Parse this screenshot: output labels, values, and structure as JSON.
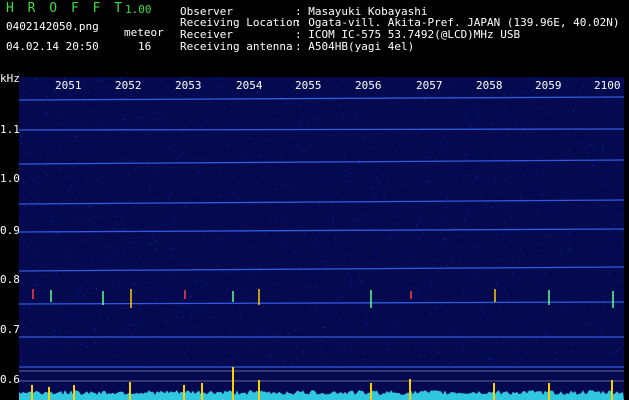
{
  "app": {
    "name_letters": "H R O F F T",
    "version": "1.00",
    "filename": "0402142050.png",
    "mode_label": "meteor",
    "datetime": "04.02.14 20:50",
    "count": "16"
  },
  "info": {
    "observer_label": "Observer",
    "observer_value": ": Masayuki Kobayashi",
    "location_label": "Receiving Location",
    "location_value": ": Ogata-vill. Akita-Pref. JAPAN (139.96E, 40.02N)",
    "receiver_label": "Receiver",
    "receiver_value": ": ICOM IC-575 53.7492(@LCD)MHz USB",
    "antenna_label": "Receiving antenna",
    "antenna_value": ": A504HB(yagi 4el)"
  },
  "spectrogram": {
    "time_labels": [
      "2051",
      "2052",
      "2053",
      "2054",
      "2055",
      "2056",
      "2057",
      "2058",
      "2059",
      "2100"
    ],
    "freq_unit": "kHz",
    "freq_labels": [
      "1.1",
      "1.0",
      "0.9",
      "0.8",
      "0.7",
      "0.6"
    ],
    "colors": {
      "background": "#050a50",
      "carrier": "#3a70ff",
      "meteor": "#ffd000",
      "baseline": "#30c8e0"
    }
  }
}
